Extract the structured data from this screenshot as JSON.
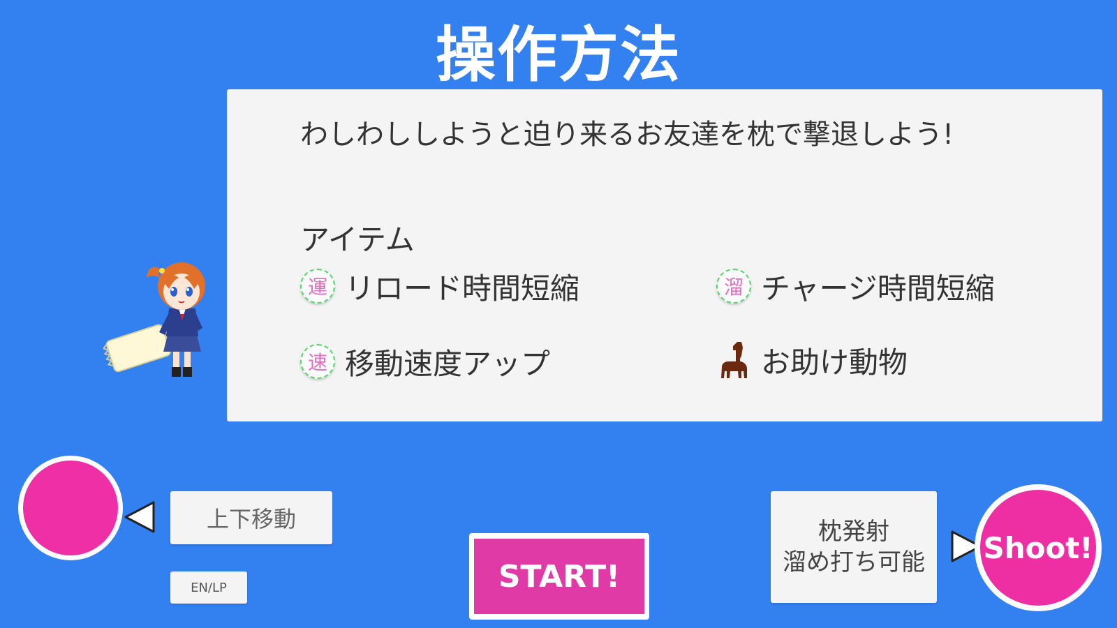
{
  "title": "操作方法",
  "intro": "わしわししようと迫り来るお友達を枕で撃退しよう!",
  "items": {
    "heading": "アイテム",
    "list": [
      {
        "badge": "運",
        "badge_color": "#e070c0",
        "label": "リロード時間短縮"
      },
      {
        "badge": "溜",
        "badge_color": "#e070c0",
        "label": "チャージ時間短縮"
      },
      {
        "badge": "速",
        "badge_color": "#e070c0",
        "label": "移動速度アップ"
      },
      {
        "icon": "alpaca-icon",
        "label": "お助け動物"
      }
    ]
  },
  "controls": {
    "move_label": "上下移動",
    "language_button": "EN/LP",
    "start_button": "START!",
    "shoot_desc_line1": "枕発射",
    "shoot_desc_line2": "溜め打ち可能",
    "shoot_button": "Shoot!"
  },
  "colors": {
    "background": "#3380f0",
    "pink": "#ef2fa5",
    "start": "#e03aa6",
    "panel": "#f4f4f4"
  }
}
